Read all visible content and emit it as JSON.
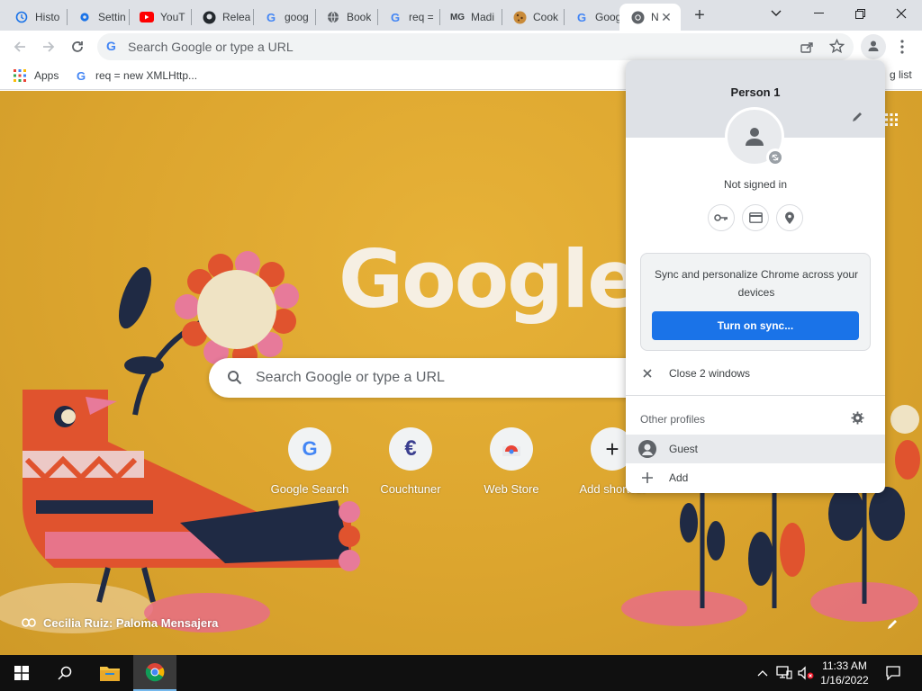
{
  "tabs": [
    {
      "label": "Histo",
      "icon": "history-icon"
    },
    {
      "label": "Settin",
      "icon": "gear-icon"
    },
    {
      "label": "YouT",
      "icon": "youtube-icon"
    },
    {
      "label": "Relea",
      "icon": "github-icon"
    },
    {
      "label": "goog",
      "icon": "google-g-icon"
    },
    {
      "label": "Book",
      "icon": "globe-icon"
    },
    {
      "label": "req =",
      "icon": "google-g-icon"
    },
    {
      "label": "Madi",
      "icon": "mg-logo-icon"
    },
    {
      "label": "Cook",
      "icon": "cookie-icon"
    },
    {
      "label": "Goog",
      "icon": "google-g-icon"
    },
    {
      "label": "N",
      "icon": "chrome-icon",
      "active": true
    }
  ],
  "tab_close": "✕",
  "omnibox": {
    "placeholder": "Search Google or type a URL"
  },
  "bookmarks": [
    {
      "label": "Apps",
      "icon": "apps-grid-icon"
    },
    {
      "label": "req = new XMLHttp...",
      "icon": "google-g-icon"
    }
  ],
  "reading_list_partial": "g list",
  "ntp": {
    "logo": "Google",
    "search_placeholder": "Search Google or type a URL",
    "shortcuts": [
      {
        "label": "Google Search",
        "icon": "google-g-icon"
      },
      {
        "label": "Couchtuner",
        "icon": "couchtuner-icon"
      },
      {
        "label": "Web Store",
        "icon": "web-store-icon"
      },
      {
        "label": "Add shortcut",
        "icon": "plus-icon"
      }
    ],
    "attribution": "Cecilia Ruiz: Paloma Mensajera"
  },
  "profile_menu": {
    "name": "Person 1",
    "status": "Not signed in",
    "sync_text": "Sync and personalize Chrome across your devices",
    "sync_button": "Turn on sync...",
    "close_windows": "Close 2 windows",
    "other_profiles": "Other profiles",
    "profiles": [
      {
        "label": "Guest",
        "icon": "guest-avatar-icon"
      },
      {
        "label": "Add",
        "icon": "plus-icon"
      }
    ]
  },
  "taskbar": {
    "time": "11:33 AM",
    "date": "1/16/2022"
  },
  "colors": {
    "ntp_background": "#dca52e",
    "sync_button": "#1a73e8",
    "tabstrip": "#dee1e6",
    "taskbar": "#101010"
  }
}
